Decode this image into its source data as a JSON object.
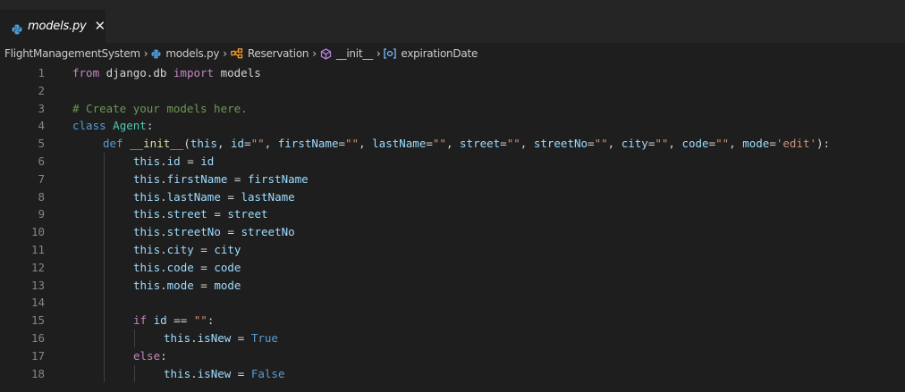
{
  "tab": {
    "label": "models.py",
    "close": "✕",
    "icon": "python-file-icon"
  },
  "breadcrumb": {
    "items": [
      {
        "label": "FlightManagementSystem",
        "icon": null
      },
      {
        "label": "models.py",
        "icon": "python-file-icon"
      },
      {
        "label": "Reservation",
        "icon": "class-icon"
      },
      {
        "label": "__init__",
        "icon": "method-icon"
      },
      {
        "label": "expirationDate",
        "icon": "field-icon"
      }
    ],
    "separator": "›"
  },
  "colors": {
    "editor_bg": "#1e1e1e",
    "tabbar_bg": "#252526",
    "keyword_control": "#c586c0",
    "keyword_decl": "#569cd6",
    "function": "#dcdcaa",
    "class": "#4ec9b0",
    "string": "#ce9178",
    "comment": "#6a9955",
    "variable": "#9cdcfe",
    "text": "#d4d4d4",
    "line_number": "#858585"
  },
  "lines": [
    {
      "n": "1",
      "indent": 0,
      "tokens": [
        [
          "kw",
          "from"
        ],
        [
          "plain",
          " django.db "
        ],
        [
          "kw",
          "import"
        ],
        [
          "plain",
          " models"
        ]
      ]
    },
    {
      "n": "2",
      "indent": 0,
      "tokens": []
    },
    {
      "n": "3",
      "indent": 0,
      "tokens": [
        [
          "cmt",
          "# Create your models here."
        ]
      ]
    },
    {
      "n": "4",
      "indent": 0,
      "tokens": [
        [
          "kd",
          "class"
        ],
        [
          "plain",
          " "
        ],
        [
          "cls",
          "Agent"
        ],
        [
          "plain",
          ":"
        ]
      ]
    },
    {
      "n": "5",
      "indent": 1,
      "tokens": [
        [
          "kd",
          "def"
        ],
        [
          "plain",
          " "
        ],
        [
          "fn",
          "__init__"
        ],
        [
          "plain",
          "("
        ],
        [
          "var",
          "this"
        ],
        [
          "plain",
          ", "
        ],
        [
          "var",
          "id"
        ],
        [
          "plain",
          "="
        ],
        [
          "str",
          "\"\""
        ],
        [
          "plain",
          ", "
        ],
        [
          "var",
          "firstName"
        ],
        [
          "plain",
          "="
        ],
        [
          "str",
          "\"\""
        ],
        [
          "plain",
          ", "
        ],
        [
          "var",
          "lastName"
        ],
        [
          "plain",
          "="
        ],
        [
          "str",
          "\"\""
        ],
        [
          "plain",
          ", "
        ],
        [
          "var",
          "street"
        ],
        [
          "plain",
          "="
        ],
        [
          "str",
          "\"\""
        ],
        [
          "plain",
          ", "
        ],
        [
          "var",
          "streetNo"
        ],
        [
          "plain",
          "="
        ],
        [
          "str",
          "\"\""
        ],
        [
          "plain",
          ", "
        ],
        [
          "var",
          "city"
        ],
        [
          "plain",
          "="
        ],
        [
          "str",
          "\"\""
        ],
        [
          "plain",
          ", "
        ],
        [
          "var",
          "code"
        ],
        [
          "plain",
          "="
        ],
        [
          "str",
          "\"\""
        ],
        [
          "plain",
          ", "
        ],
        [
          "var",
          "mode"
        ],
        [
          "plain",
          "="
        ],
        [
          "str",
          "'edit'"
        ],
        [
          "plain",
          "):"
        ]
      ]
    },
    {
      "n": "6",
      "indent": 2,
      "tokens": [
        [
          "var",
          "this"
        ],
        [
          "plain",
          "."
        ],
        [
          "var",
          "id"
        ],
        [
          "plain",
          " = "
        ],
        [
          "var",
          "id"
        ]
      ]
    },
    {
      "n": "7",
      "indent": 2,
      "tokens": [
        [
          "var",
          "this"
        ],
        [
          "plain",
          "."
        ],
        [
          "var",
          "firstName"
        ],
        [
          "plain",
          " = "
        ],
        [
          "var",
          "firstName"
        ]
      ]
    },
    {
      "n": "8",
      "indent": 2,
      "tokens": [
        [
          "var",
          "this"
        ],
        [
          "plain",
          "."
        ],
        [
          "var",
          "lastName"
        ],
        [
          "plain",
          " = "
        ],
        [
          "var",
          "lastName"
        ]
      ]
    },
    {
      "n": "9",
      "indent": 2,
      "tokens": [
        [
          "var",
          "this"
        ],
        [
          "plain",
          "."
        ],
        [
          "var",
          "street"
        ],
        [
          "plain",
          " = "
        ],
        [
          "var",
          "street"
        ]
      ]
    },
    {
      "n": "10",
      "indent": 2,
      "tokens": [
        [
          "var",
          "this"
        ],
        [
          "plain",
          "."
        ],
        [
          "var",
          "streetNo"
        ],
        [
          "plain",
          " = "
        ],
        [
          "var",
          "streetNo"
        ]
      ]
    },
    {
      "n": "11",
      "indent": 2,
      "tokens": [
        [
          "var",
          "this"
        ],
        [
          "plain",
          "."
        ],
        [
          "var",
          "city"
        ],
        [
          "plain",
          " = "
        ],
        [
          "var",
          "city"
        ]
      ]
    },
    {
      "n": "12",
      "indent": 2,
      "tokens": [
        [
          "var",
          "this"
        ],
        [
          "plain",
          "."
        ],
        [
          "var",
          "code"
        ],
        [
          "plain",
          " = "
        ],
        [
          "var",
          "code"
        ]
      ]
    },
    {
      "n": "13",
      "indent": 2,
      "tokens": [
        [
          "var",
          "this"
        ],
        [
          "plain",
          "."
        ],
        [
          "var",
          "mode"
        ],
        [
          "plain",
          " = "
        ],
        [
          "var",
          "mode"
        ]
      ]
    },
    {
      "n": "14",
      "indent": 2,
      "tokens": []
    },
    {
      "n": "15",
      "indent": 2,
      "tokens": [
        [
          "kw",
          "if"
        ],
        [
          "plain",
          " "
        ],
        [
          "var",
          "id"
        ],
        [
          "plain",
          " == "
        ],
        [
          "str",
          "\"\""
        ],
        [
          "plain",
          ":"
        ]
      ]
    },
    {
      "n": "16",
      "indent": 3,
      "tokens": [
        [
          "var",
          "this"
        ],
        [
          "plain",
          "."
        ],
        [
          "var",
          "isNew"
        ],
        [
          "plain",
          " = "
        ],
        [
          "kd",
          "True"
        ]
      ]
    },
    {
      "n": "17",
      "indent": 2,
      "tokens": [
        [
          "kw",
          "else"
        ],
        [
          "plain",
          ":"
        ]
      ]
    },
    {
      "n": "18",
      "indent": 3,
      "tokens": [
        [
          "var",
          "this"
        ],
        [
          "plain",
          "."
        ],
        [
          "var",
          "isNew"
        ],
        [
          "plain",
          " = "
        ],
        [
          "kd",
          "False"
        ]
      ]
    }
  ]
}
